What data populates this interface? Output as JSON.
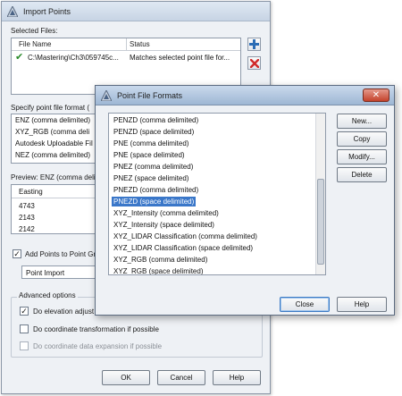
{
  "import_dialog": {
    "title": "Import Points",
    "selected_files_label": "Selected Files:",
    "columns": [
      "File Name",
      "Status"
    ],
    "files": [
      {
        "name": "C:\\Mastering\\Ch3\\059745c...",
        "status": "Matches selected point file for..."
      }
    ],
    "format_label": "Specify point file format (",
    "formats_visible": [
      "ENZ (comma delimited)",
      "XYZ_RGB (comma deli",
      "Autodesk Uploadable Fil",
      "NEZ (comma delimited)"
    ],
    "preview_label": "Preview: ENZ (comma deli",
    "preview_header": "Easting",
    "preview_rows": [
      "4743",
      "2143",
      "2142"
    ],
    "add_points_label": "Add Points to Point Gr",
    "add_points_checked": "✓",
    "point_group_value": "Point Import",
    "advanced_label": "Advanced options",
    "opt_elevation": "Do elevation adjust",
    "opt_elevation_checked": "✓",
    "opt_transform": "Do coordinate transformation if possible",
    "opt_expansion": "Do coordinate data expansion if possible",
    "ok_label": "OK",
    "cancel_label": "Cancel",
    "help_label": "Help"
  },
  "formats_dialog": {
    "title": "Point File Formats",
    "close_symbol": "✕",
    "items": [
      "PENZD (comma delimited)",
      "PENZD (space delimited)",
      "PNE (comma delimited)",
      "PNE (space delimited)",
      "PNEZ (comma delimited)",
      "PNEZ (space delimited)",
      "PNEZD (comma delimited)",
      "PNEZD (space delimited)",
      "XYZ_Intensity (comma delimited)",
      "XYZ_Intensity (space delimited)",
      "XYZ_LIDAR Classification (comma delimited)",
      "XYZ_LIDAR Classification (space delimited)",
      "XYZ_RGB (comma delimited)",
      "XYZ_RGB (space delimited)"
    ],
    "selected_index": 7,
    "new_label": "New...",
    "copy_label": "Copy",
    "modify_label": "Modify...",
    "delete_label": "Delete",
    "close_label": "Close",
    "help_label": "Help"
  },
  "colors": {
    "selection": "#3a77c9",
    "check": "#2a8a2a",
    "remove": "#d02a2a",
    "add": "#2c6db5"
  }
}
